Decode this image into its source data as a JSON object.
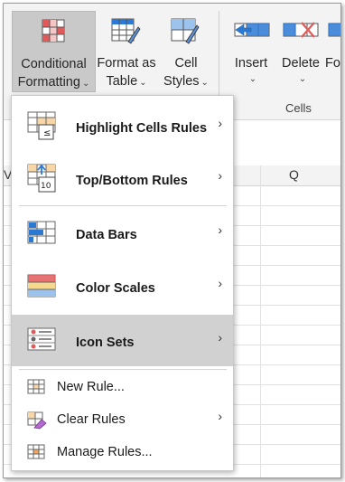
{
  "ribbon": {
    "conditional_formatting": {
      "line1": "Conditional",
      "line2": "Formatting"
    },
    "format_as_table": {
      "line1": "Format as",
      "line2": "Table"
    },
    "cell_styles": {
      "line1": "Cell",
      "line2": "Styles"
    },
    "insert": {
      "label": "Insert"
    },
    "delete": {
      "label": "Delete"
    },
    "format": {
      "label": "Fo"
    },
    "cells_group_label": "Cells",
    "chevron": "⌄"
  },
  "sheet": {
    "column_q": "Q",
    "column_partial": "V"
  },
  "menu": {
    "items": [
      {
        "label": "Highlight Cells Rules",
        "icon": "highlight-cells-icon",
        "submenu": true
      },
      {
        "label": "Top/Bottom Rules",
        "icon": "top-bottom-icon",
        "submenu": true
      },
      {
        "label": "Data Bars",
        "icon": "data-bars-icon",
        "submenu": true
      },
      {
        "label": "Color Scales",
        "icon": "color-scales-icon",
        "submenu": true
      },
      {
        "label": "Icon Sets",
        "icon": "icon-sets-icon",
        "submenu": true,
        "selected": true
      },
      {
        "label": "New Rule...",
        "icon": "new-rule-icon",
        "submenu": false
      },
      {
        "label": "Clear Rules",
        "icon": "clear-rules-icon",
        "submenu": true
      },
      {
        "label": "Manage Rules...",
        "icon": "manage-rules-icon",
        "submenu": false
      }
    ],
    "submenu_arrow": "›"
  },
  "colors": {
    "accent_blue": "#2b79d3",
    "accent_red": "#e05a5a",
    "selected_bg": "#d1d1d1",
    "ribbon_bg": "#f3f3f3"
  }
}
